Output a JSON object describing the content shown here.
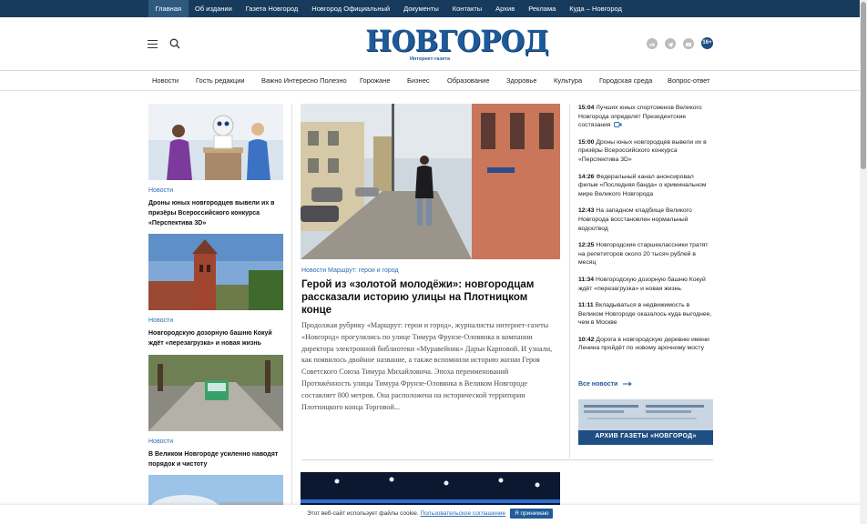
{
  "top_nav": [
    "Главная",
    "Об издании",
    "Газета Новгород",
    "Новгород Официальный",
    "Документы",
    "Контакты",
    "Архив",
    "Реклама",
    "Куда – Новгород"
  ],
  "logo": {
    "word": "НОВГОРОД",
    "subtitle": "Интернет-газета"
  },
  "age_rating": "16+",
  "social_icons": [
    "vk-icon",
    "telegram-icon",
    "youtube-icon"
  ],
  "categories": [
    "Новости",
    "Гость редакции",
    "Важно Интересно Полезно",
    "Горожане",
    "Бизнес",
    "Образование",
    "Здоровье",
    "Культура",
    "Городская среда",
    "Вопрос-ответ"
  ],
  "left_cards": [
    {
      "rubric": "Новости",
      "title": "Дроны юных новгородцев вывели их в призёры Всероссийского конкурса «Перспектива 3D»"
    },
    {
      "rubric": "Новости",
      "title": "Новгородскую дозорную башню Кокуй ждёт «перезагрузка» и новая жизнь"
    },
    {
      "rubric": "Новости",
      "title": "В Великом Новгороде усиленно наводят порядок и чистоту"
    }
  ],
  "main_article": {
    "rubric": "Новости Маршрут: герои и город",
    "title": "Герой из «золотой молодёжи»: новгородцам рассказали историю улицы на Плотницком конце",
    "text": "Продолжая рубрику «Маршрут: герои и город», журналисты интернет-газеты «Новгород» прогулялись по улице Тимура Фрунзе-Оловянка в компании директора электронной библиотеки «Муравейник» Дарьи Карповой. И узнали, как появилось двойное название, а также вспомнили историю жизни Героя Советского Союза Тимура Михайловича.  Эпоха переименований Протяжённость улицы Тимура Фрунзе-Оловянка в Великом Новгороде составляет 800 метров. Она расположена на исторической территории Плотницкого конца Торговой..."
  },
  "news_feed": [
    {
      "time": "15:04",
      "text": "Лучших юных спортсменов Великого Новгорода определят Президентские состязания",
      "has_video": true
    },
    {
      "time": "15:00",
      "text": "Дроны юных новгородцев вывели их в призёры Всероссийского конкурса «Перспектива 3D»"
    },
    {
      "time": "14:26",
      "text": "Федеральный канал анонсировал фильм «Последняя банда» о криминальном мире Великого Новгорода"
    },
    {
      "time": "12:43",
      "text": "На западном кладбище Великого Новгорода восстановлен нормальный водоотвод"
    },
    {
      "time": "12:25",
      "text": "Новгородские старшеклассники тратят на репетиторов около 20 тысяч рублей в месяц"
    },
    {
      "time": "11:34",
      "text": "Новгородскую дозорную башню Кокуй ждёт «перезагрузка» и новая жизнь"
    },
    {
      "time": "11:11",
      "text": "Вкладываться в недвижимость в Великом Новгороде оказалось куда выгоднее, чем в Москве"
    },
    {
      "time": "10:42",
      "text": "Дорога в новгородскую деревню имени Ленина пройдёт по новому арочному мосту"
    }
  ],
  "all_news_label": "Все новости",
  "archive_banner": "АРХИВ ГАЗЕТЫ «НОВГОРОД»",
  "cookie": {
    "text": "Этот веб-сайт использует файлы cookie.",
    "link": "Пользовательское соглашение",
    "button": "Я принимаю"
  },
  "colors": {
    "topbar": "#163b5c",
    "accent": "#1e5a9a",
    "rubric": "#2a6fb3"
  }
}
